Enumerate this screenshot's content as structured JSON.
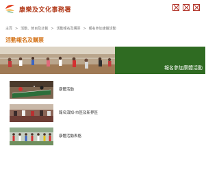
{
  "header": {
    "site_title": "康樂及文化事務署",
    "logo_icon": "lcsd-logo-icon",
    "tools": [
      {
        "icon": "tool-icon-1"
      },
      {
        "icon": "tool-icon-2"
      },
      {
        "icon": "tool-icon-3"
      }
    ]
  },
  "breadcrumb": [
    "主頁",
    "活動、節目及計劃",
    "活動報名及購票",
    "報名參加康體活動"
  ],
  "page_title": "活動報名及購票",
  "banner": {
    "caption": "報名參加康體活動",
    "accent_color": "#2f6b22"
  },
  "list": [
    {
      "label": "康體活動",
      "thumb": "table-tennis-thumbnail"
    },
    {
      "label": "報名須知-市區及新界區",
      "thumb": "hall-thumbnail"
    },
    {
      "label": "康體活動表格",
      "thumb": "group-thumbnail"
    }
  ]
}
